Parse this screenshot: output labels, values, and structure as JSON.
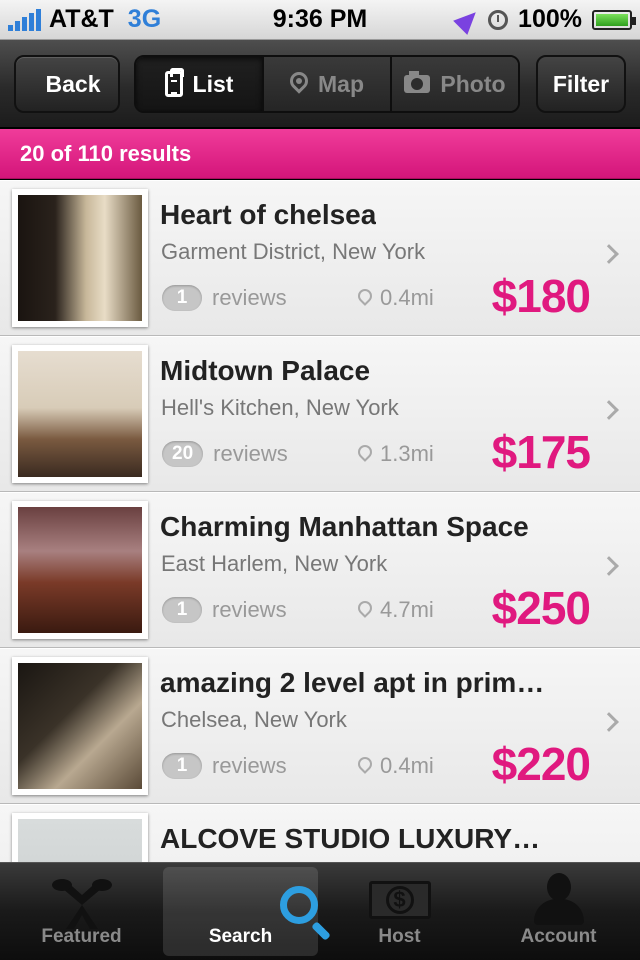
{
  "status_bar": {
    "carrier": "AT&T",
    "network": "3G",
    "time": "9:36 PM",
    "battery": "100%",
    "icons": [
      "signal-bars-icon",
      "location-arrow-icon",
      "alarm-clock-icon",
      "battery-charging-icon"
    ]
  },
  "nav": {
    "back_label": "Back",
    "segments": [
      {
        "label": "List",
        "icon": "clipboard-list-icon",
        "active": true
      },
      {
        "label": "Map",
        "icon": "map-pin-icon",
        "active": false
      },
      {
        "label": "Photo",
        "icon": "camera-icon",
        "active": false
      }
    ],
    "filter_label": "Filter"
  },
  "results": {
    "summary": "20 of 110 results"
  },
  "colors": {
    "accent_pink": "#e0197f",
    "banner_pink": "#e62a8c",
    "search_blue": "#2d9ee0"
  },
  "listings": [
    {
      "title": "Heart of chelsea",
      "location": "Garment District, New York",
      "reviews_count": "1",
      "reviews_label": "reviews",
      "distance": "0.4mi",
      "price": "$180"
    },
    {
      "title": "Midtown Palace",
      "location": "Hell's Kitchen, New York",
      "reviews_count": "20",
      "reviews_label": "reviews",
      "distance": "1.3mi",
      "price": "$175"
    },
    {
      "title": "Charming Manhattan Space",
      "location": "East Harlem, New York",
      "reviews_count": "1",
      "reviews_label": "reviews",
      "distance": "4.7mi",
      "price": "$250"
    },
    {
      "title": "amazing 2 level apt in prim…",
      "location": "Chelsea, New York",
      "reviews_count": "1",
      "reviews_label": "reviews",
      "distance": "0.4mi",
      "price": "$220"
    },
    {
      "title": "ALCOVE STUDIO LUXURY…",
      "location": "",
      "reviews_count": "",
      "reviews_label": "",
      "distance": "",
      "price": ""
    }
  ],
  "tab_bar": {
    "tabs": [
      {
        "label": "Featured",
        "icon": "featured-icon",
        "active": false
      },
      {
        "label": "Search",
        "icon": "search-icon",
        "active": true
      },
      {
        "label": "Host",
        "icon": "dollar-bill-icon",
        "active": false
      },
      {
        "label": "Account",
        "icon": "user-silhouette-icon",
        "active": false
      }
    ]
  }
}
